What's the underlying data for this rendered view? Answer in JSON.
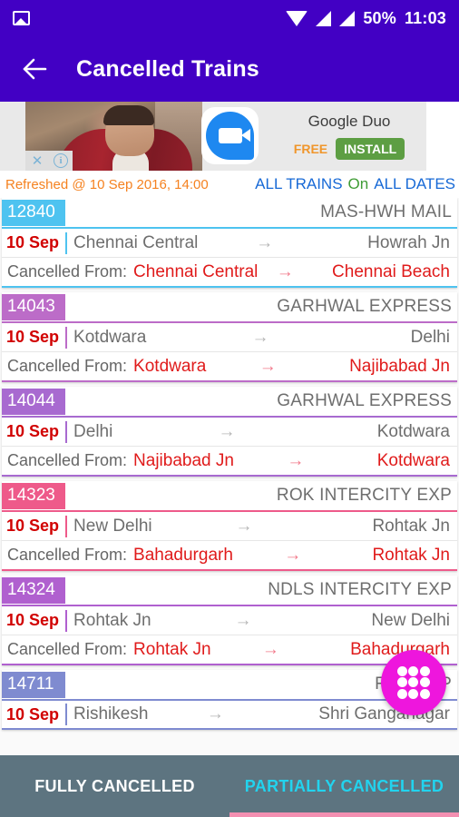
{
  "status_bar": {
    "image_icon": "image-icon",
    "wifi_icon": "wifi-icon",
    "signal_icon_1": "signal-bars-icon",
    "signal_icon_2": "signal-bars-icon",
    "battery": "50%",
    "time": "11:03"
  },
  "toolbar": {
    "back_icon": "back-arrow-icon",
    "title": "Cancelled Trains",
    "background": "#4200C4"
  },
  "ad": {
    "close_label": "✕",
    "info_label": "i",
    "app_name": "Google Duo",
    "price_label": "FREE",
    "install_label": "INSTALL",
    "install_color": "#5d9e43",
    "free_color": "#f0962c"
  },
  "refresh": {
    "text": "Refreshed @ 10 Sep 2016, 14:00",
    "color": "#f58220"
  },
  "filters": {
    "all_trains": "ALL TRAINS",
    "on": "On",
    "all_dates": "ALL DATES",
    "link_color": "#1769d6",
    "on_color": "#3f9c35"
  },
  "trains": [
    {
      "number": "12840",
      "name": "MAS-HWH MAIL",
      "color": "#4ec3f0",
      "date": "10 Sep",
      "source": "Chennai Central",
      "destination": "Howrah Jn",
      "cancelled_label": "Cancelled From:",
      "cancelled_from": "Chennai Central",
      "cancelled_to": "Chennai Beach",
      "arrow": "→"
    },
    {
      "number": "14043",
      "name": "GARHWAL EXPRESS",
      "color": "#bc6cc8",
      "date": "10 Sep",
      "source": "Kotdwara",
      "destination": "Delhi",
      "cancelled_label": "Cancelled From:",
      "cancelled_from": "Kotdwara",
      "cancelled_to": "Najibabad Jn",
      "arrow": "→"
    },
    {
      "number": "14044",
      "name": "GARHWAL EXPRESS",
      "color": "#a86ad0",
      "date": "10 Sep",
      "source": "Delhi",
      "destination": "Kotdwara",
      "cancelled_label": "Cancelled From:",
      "cancelled_from": "Najibabad Jn",
      "cancelled_to": "Kotdwara",
      "arrow": "→"
    },
    {
      "number": "14323",
      "name": "ROK INTERCITY EXP",
      "color": "#ee5a8a",
      "date": "10 Sep",
      "source": "New Delhi",
      "destination": "Rohtak Jn",
      "cancelled_label": "Cancelled From:",
      "cancelled_from": "Bahadurgarh",
      "cancelled_to": "Rohtak Jn",
      "arrow": "→"
    },
    {
      "number": "14324",
      "name": "NDLS INTERCITY EXP",
      "color": "#b060cf",
      "date": "10 Sep",
      "source": "Rohtak Jn",
      "destination": "New Delhi",
      "cancelled_label": "Cancelled From:",
      "cancelled_from": "Rohtak Jn",
      "cancelled_to": "Bahadurgarh",
      "arrow": "→"
    },
    {
      "number": "14711",
      "name": "RKSH                 XP",
      "color": "#7f8bd0",
      "date": "10 Sep",
      "source": "Rishikesh",
      "destination": "Shri Ganganagar",
      "cancelled_label": "",
      "cancelled_from": "",
      "cancelled_to": "",
      "arrow": "→"
    }
  ],
  "fab": {
    "icon": "grid-apps-icon",
    "color": "#ee16dd"
  },
  "tabs": {
    "background": "#5d7480",
    "items": [
      {
        "label": "FULLY CANCELLED",
        "active": false
      },
      {
        "label": "PARTIALLY CANCELLED",
        "active": true
      }
    ],
    "indicator_color": "#f48fb1",
    "active_color": "#22d3ee"
  }
}
